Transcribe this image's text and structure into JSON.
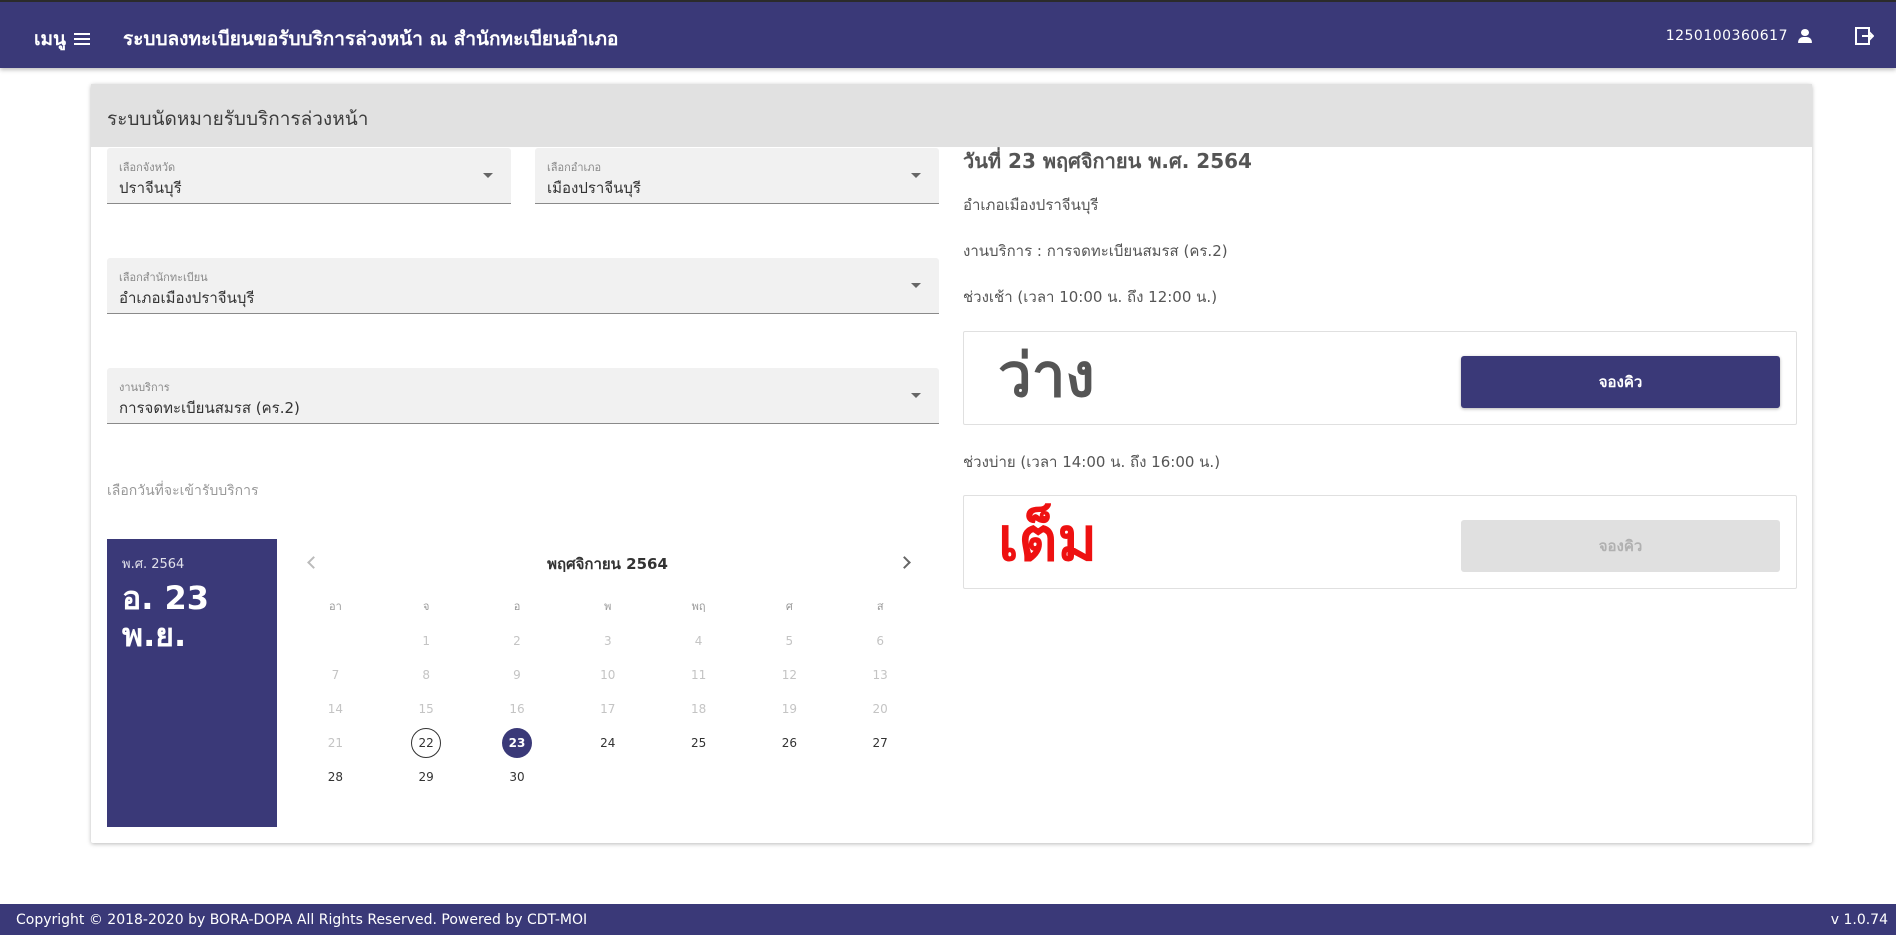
{
  "header": {
    "menu_label": "เมนู",
    "title": "ระบบลงทะเบียนขอรับบริการล่วงหน้า ณ สำนักทะเบียนอำเภอ",
    "user_id": "1250100360617",
    "user_icon": "person-icon",
    "logout_icon": "logout-icon"
  },
  "card": {
    "title": "ระบบนัดหมายรับบริการล่วงหน้า"
  },
  "form": {
    "province": {
      "label": "เลือกจังหวัด",
      "value": "ปราจีนบุรี"
    },
    "district": {
      "label": "เลือกอำเภอ",
      "value": "เมืองปราจีนบุรี"
    },
    "office": {
      "label": "เลือกสำนักทะเบียน",
      "value": "อำเภอเมืองปราจีนบุรี"
    },
    "service": {
      "label": "งานบริการ",
      "value": "การจดทะเบียนสมรส (คร.2)"
    },
    "date_label": "เลือกวันที่จะเข้ารับบริการ"
  },
  "picker": {
    "year": "พ.ศ. 2564",
    "date_line1": "อ. 23",
    "date_line2": "พ.ย.",
    "month_title": "พฤศจิกายน 2564",
    "weekdays": [
      "อา",
      "จ",
      "อ",
      "พ",
      "พฤ",
      "ศ",
      "ส"
    ],
    "weeks": [
      [
        "",
        "1",
        "2",
        "3",
        "4",
        "5",
        "6"
      ],
      [
        "7",
        "8",
        "9",
        "10",
        "11",
        "12",
        "13"
      ],
      [
        "14",
        "15",
        "16",
        "17",
        "18",
        "19",
        "20"
      ],
      [
        "21",
        "22",
        "23",
        "24",
        "25",
        "26",
        "27"
      ],
      [
        "28",
        "29",
        "30",
        "",
        "",
        "",
        ""
      ]
    ],
    "today": "22",
    "selected": "23",
    "first_enabled": 22
  },
  "detail": {
    "date_title": "วันที่ 23 พฤศจิกายน พ.ศ. 2564",
    "office": "อำเภอเมืองปราจีนบุรี",
    "service": "งานบริการ : การจดทะเบียนสมรส (คร.2)",
    "morning_label": "ช่วงเช้า (เวลา 10:00 น. ถึง 12:00 น.)",
    "morning_status": "ว่าง",
    "morning_status_color": "#555555",
    "morning_button": "จองคิว",
    "afternoon_label": "ช่วงบ่าย (เวลา 14:00 น. ถึง 16:00 น.)",
    "afternoon_status": "เต็ม",
    "afternoon_status_color": "#ee1111",
    "afternoon_button": "จองคิว"
  },
  "footer": {
    "copyright": "Copyright © 2018-2020 by BORA-DOPA All Rights Reserved. Powered by CDT-MOI",
    "version": "v 1.0.74"
  }
}
